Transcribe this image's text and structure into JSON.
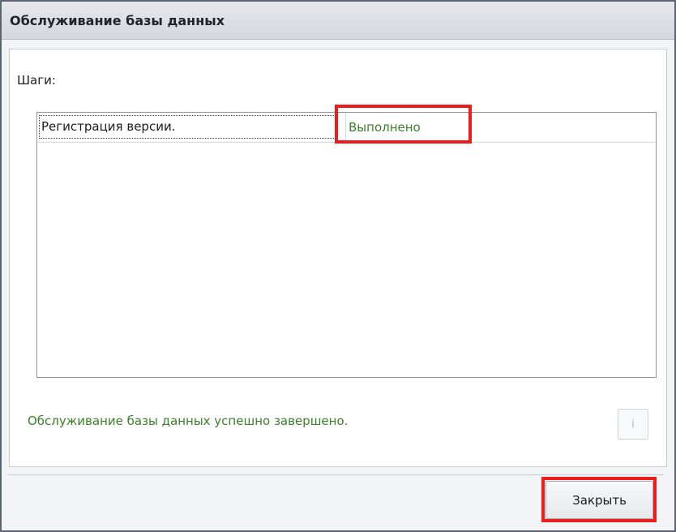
{
  "window": {
    "title": "Обслуживание базы данных"
  },
  "steps": {
    "label": "Шаги:",
    "rows": [
      {
        "step": "Регистрация версии.",
        "status": "Выполнено"
      }
    ]
  },
  "status_message": "Обслуживание базы данных успешно завершено.",
  "info_button": {
    "icon": "info-icon",
    "glyph": "i"
  },
  "buttons": {
    "close_label": "Закрыть"
  },
  "colors": {
    "highlight": "#ee1c1c",
    "success_text": "#3d7f2a"
  }
}
